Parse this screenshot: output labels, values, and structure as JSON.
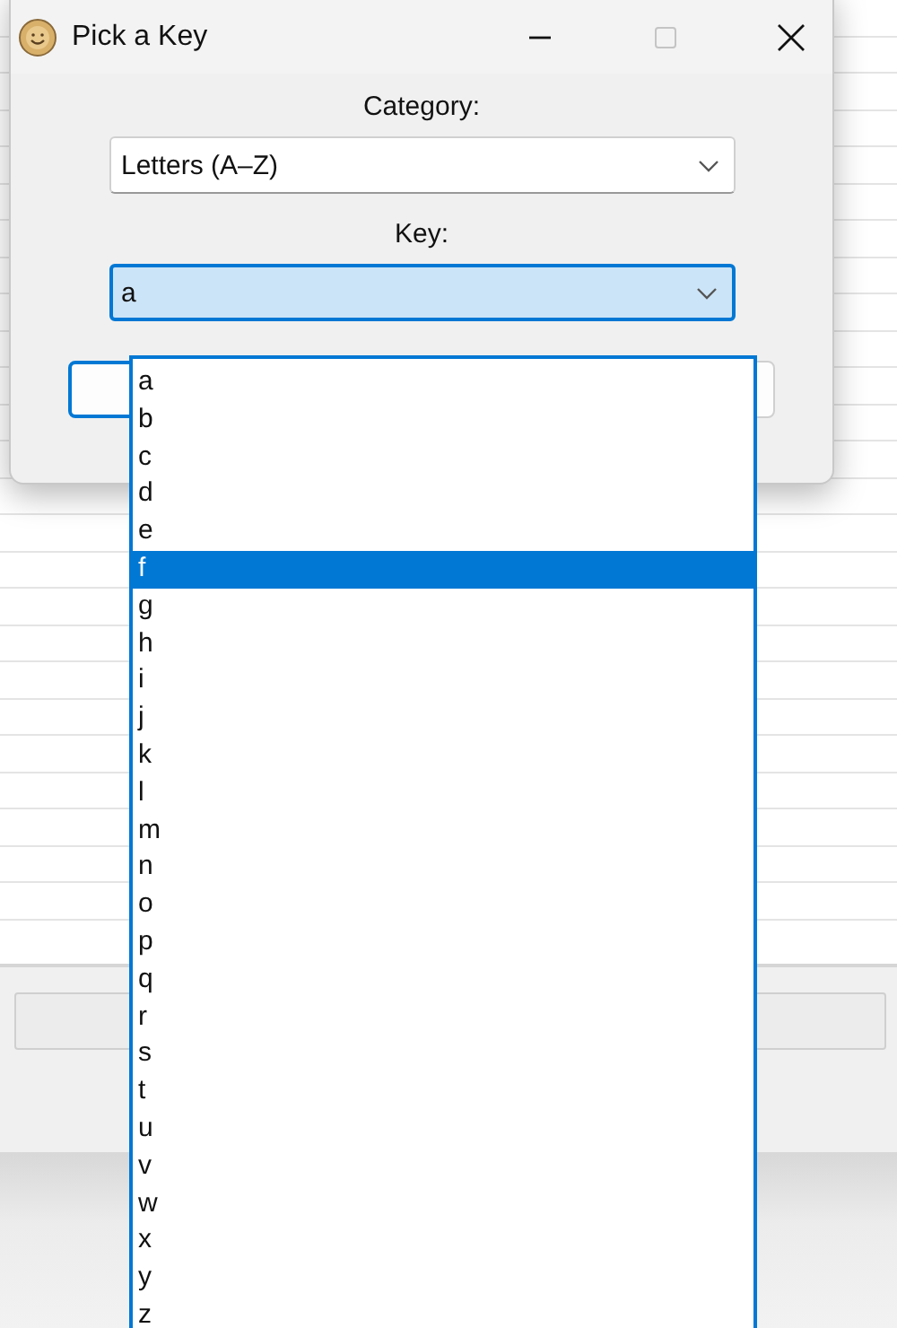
{
  "window": {
    "title": "Pick a Key"
  },
  "category": {
    "label": "Category:",
    "value": "Letters (A–Z)"
  },
  "key": {
    "label": "Key:",
    "value": "a",
    "expanded": true
  },
  "options": [
    {
      "label": "a",
      "selected": false
    },
    {
      "label": "b",
      "selected": false
    },
    {
      "label": "c",
      "selected": false
    },
    {
      "label": "d",
      "selected": false
    },
    {
      "label": "e",
      "selected": false
    },
    {
      "label": "f",
      "selected": true
    },
    {
      "label": "g",
      "selected": false
    },
    {
      "label": "h",
      "selected": false
    },
    {
      "label": "i",
      "selected": false
    },
    {
      "label": "j",
      "selected": false
    },
    {
      "label": "k",
      "selected": false
    },
    {
      "label": "l",
      "selected": false
    },
    {
      "label": "m",
      "selected": false
    },
    {
      "label": "n",
      "selected": false
    },
    {
      "label": "o",
      "selected": false
    },
    {
      "label": "p",
      "selected": false
    },
    {
      "label": "q",
      "selected": false
    },
    {
      "label": "r",
      "selected": false
    },
    {
      "label": "s",
      "selected": false
    },
    {
      "label": "t",
      "selected": false
    },
    {
      "label": "u",
      "selected": false
    },
    {
      "label": "v",
      "selected": false
    },
    {
      "label": "w",
      "selected": false
    },
    {
      "label": "x",
      "selected": false
    },
    {
      "label": "y",
      "selected": false
    },
    {
      "label": "z",
      "selected": false
    }
  ]
}
